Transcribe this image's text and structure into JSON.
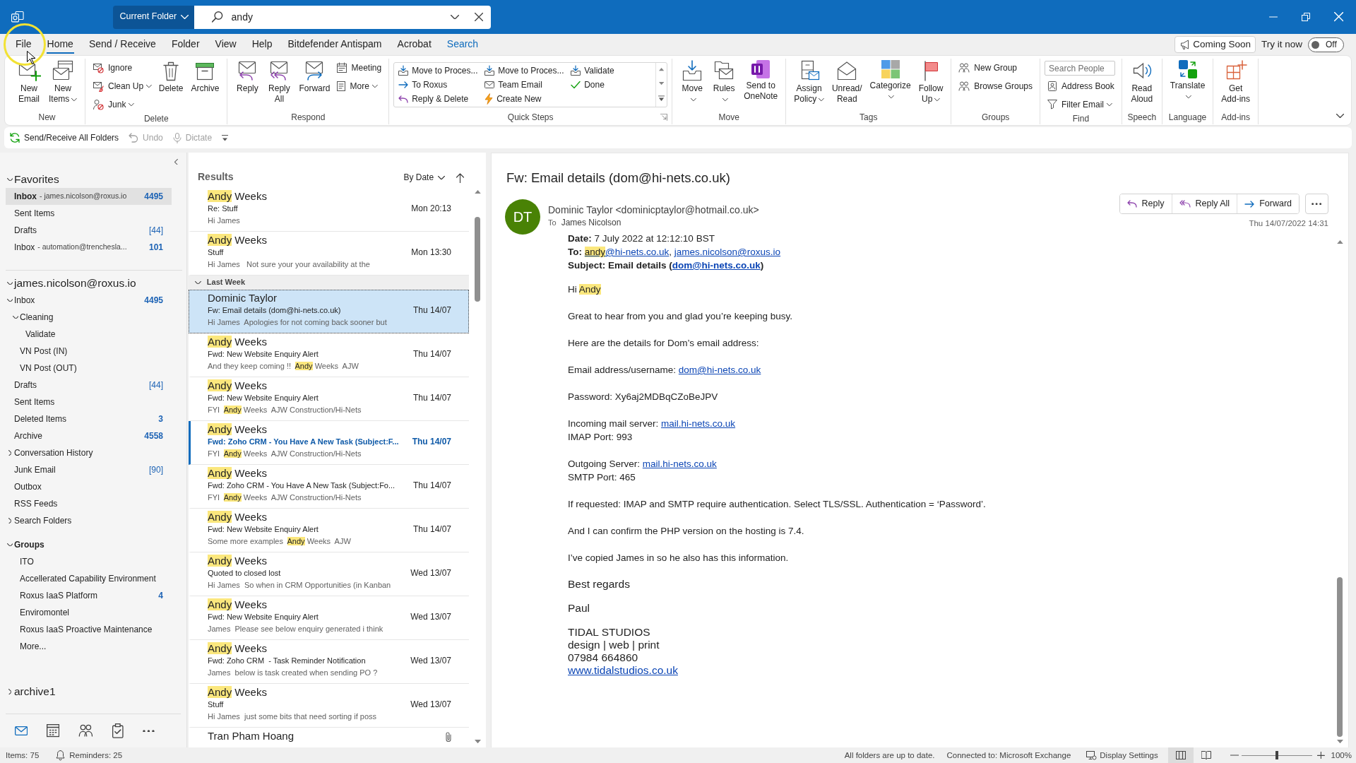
{
  "title_bar": {
    "scope": "Current Folder",
    "search": {
      "value": "andy"
    }
  },
  "menu_tabs": [
    {
      "label": "File",
      "selected": false,
      "kind": "standard"
    },
    {
      "label": "Home",
      "selected": true,
      "kind": "standard"
    },
    {
      "label": "Send / Receive",
      "selected": false,
      "kind": "standard"
    },
    {
      "label": "Folder",
      "selected": false,
      "kind": "standard"
    },
    {
      "label": "View",
      "selected": false,
      "kind": "standard"
    },
    {
      "label": "Help",
      "selected": false,
      "kind": "standard"
    },
    {
      "label": "Bitdefender Antispam",
      "selected": false,
      "kind": "standard"
    },
    {
      "label": "Acrobat",
      "selected": false,
      "kind": "standard"
    },
    {
      "label": "Search",
      "selected": false,
      "kind": "contextual"
    }
  ],
  "coming_soon": "Coming Soon",
  "try_it_now": {
    "label": "Try it now",
    "toggle": {
      "label": "Off",
      "on": false
    }
  },
  "ribbon": {
    "groups": [
      {
        "label": "New",
        "items": [
          {
            "kind": "large",
            "lines": [
              "New",
              "Email"
            ],
            "menu": false
          },
          {
            "kind": "large",
            "lines": [
              "New",
              "Items"
            ],
            "menu": true
          }
        ]
      },
      {
        "label": "Delete",
        "items": [
          {
            "kind": "stack",
            "items": [
              {
                "label": "Ignore",
                "menu": false
              },
              {
                "label": "Clean Up",
                "menu": true
              },
              {
                "label": "Junk",
                "menu": true
              }
            ]
          },
          {
            "kind": "large",
            "lines": [
              "Delete"
            ],
            "menu": false
          },
          {
            "kind": "large",
            "lines": [
              "Archive"
            ],
            "menu": false
          }
        ]
      },
      {
        "label": "Respond",
        "items": [
          {
            "kind": "large",
            "lines": [
              "Reply"
            ],
            "menu": false
          },
          {
            "kind": "large",
            "lines": [
              "Reply",
              "All"
            ],
            "menu": false
          },
          {
            "kind": "large",
            "lines": [
              "Forward"
            ],
            "menu": false
          },
          {
            "kind": "stack",
            "items": [
              {
                "label": "Meeting",
                "menu": false
              },
              {
                "label": "More",
                "menu": true
              }
            ]
          }
        ]
      },
      {
        "label": "Quick Steps",
        "items": [
          {
            "kind": "gallery",
            "items": [
              "Move to Proces...",
              "To Roxus",
              "Reply & Delete",
              "Move to Proces...",
              "Team Email",
              "Create New",
              "Validate",
              "Done"
            ]
          }
        ]
      },
      {
        "label": "Move",
        "items": [
          {
            "kind": "large",
            "lines": [
              "Move"
            ],
            "menu": true
          },
          {
            "kind": "large",
            "lines": [
              "Rules"
            ],
            "menu": true
          },
          {
            "kind": "large",
            "lines": [
              "Send to",
              "OneNote"
            ],
            "menu": false
          }
        ]
      },
      {
        "label": "Tags",
        "items": [
          {
            "kind": "large",
            "lines": [
              "Assign",
              "Policy"
            ],
            "menu": true
          },
          {
            "kind": "large",
            "lines": [
              "Unread/",
              "Read"
            ],
            "menu": false
          },
          {
            "kind": "large",
            "lines": [
              "Categorize"
            ],
            "menu": true
          },
          {
            "kind": "large",
            "lines": [
              "Follow",
              "Up"
            ],
            "menu": true
          }
        ]
      },
      {
        "label": "Groups",
        "items": [
          {
            "kind": "stack",
            "items": [
              {
                "label": "New Group",
                "menu": false
              },
              {
                "label": "Browse Groups",
                "menu": false
              }
            ]
          }
        ]
      },
      {
        "label": "Find",
        "items": [
          {
            "kind": "stack",
            "items": [
              {
                "kind": "field",
                "placeholder": "Search People"
              },
              {
                "kind": "button",
                "label": "Address Book",
                "menu": false
              },
              {
                "kind": "button",
                "label": "Filter Email",
                "menu": true
              }
            ]
          }
        ]
      },
      {
        "label": "Speech",
        "items": [
          {
            "kind": "large",
            "lines": [
              "Read",
              "Aloud"
            ],
            "menu": false
          }
        ]
      },
      {
        "label": "Language",
        "items": [
          {
            "kind": "large",
            "lines": [
              "Translate"
            ],
            "menu": true
          }
        ]
      },
      {
        "label": "Add-ins",
        "items": [
          {
            "kind": "large",
            "lines": [
              "Get",
              "Add-ins"
            ],
            "menu": false
          }
        ]
      }
    ]
  },
  "quick_access": [
    {
      "label": "Send/Receive All Folders",
      "disabled": false
    },
    {
      "label": "Undo",
      "disabled": true
    },
    {
      "label": "Dictate",
      "disabled": true
    }
  ],
  "folder_pane": {
    "sections": [
      {
        "kind": "favorites",
        "label": "Favorites",
        "expanded": true,
        "folders": [
          {
            "label": "Inbox",
            "account": "- james.nicolson@roxus.io",
            "count": "4495",
            "count_unread": true,
            "selected": true
          },
          {
            "label": "Sent Items",
            "selected": false
          },
          {
            "label": "Drafts",
            "count": "[44]",
            "count_unread": false,
            "selected": false
          },
          {
            "label": "Inbox",
            "account": "- automation@trenchesla...",
            "count": "101",
            "count_unread": true,
            "selected": false
          }
        ]
      },
      {
        "kind": "account",
        "label": "james.nicolson@roxus.io",
        "expanded": true,
        "folders": [
          {
            "label": "Inbox",
            "count": "4495",
            "count_unread": true,
            "selected": false,
            "expanded": true,
            "children": [
              {
                "label": "Cleaning",
                "selected": false,
                "expanded": true,
                "children": [
                  {
                    "label": "Validate",
                    "selected": false
                  }
                ]
              },
              {
                "label": "VN Post (IN)",
                "selected": false
              },
              {
                "label": "VN Post (OUT)",
                "selected": false
              }
            ]
          },
          {
            "label": "Drafts",
            "count": "[44]",
            "count_unread": false,
            "selected": false
          },
          {
            "label": "Sent Items",
            "selected": false
          },
          {
            "label": "Deleted Items",
            "count": "3",
            "count_unread": true,
            "selected": false
          },
          {
            "label": "Archive",
            "count": "4558",
            "count_unread": true,
            "selected": false
          },
          {
            "label": "Conversation History",
            "selected": false,
            "expanded": false
          },
          {
            "label": "Junk Email",
            "count": "[90]",
            "count_unread": false,
            "selected": false
          },
          {
            "label": "Outbox",
            "selected": false
          },
          {
            "label": "RSS Feeds",
            "selected": false
          },
          {
            "label": "Search Folders",
            "selected": false,
            "expanded": false
          }
        ]
      },
      {
        "kind": "groups",
        "label": "Groups",
        "expanded": true,
        "folders": [
          {
            "label": "ITO",
            "selected": false
          },
          {
            "label": "Accellerated Capability Environment",
            "selected": false
          },
          {
            "label": "Roxus IaaS Platform",
            "count": "4",
            "count_unread": true,
            "selected": false
          },
          {
            "label": "Enviromontel",
            "selected": false
          },
          {
            "label": "Roxus IaaS Proactive Maintenance",
            "selected": false
          },
          {
            "label": "More...",
            "selected": false
          }
        ]
      },
      {
        "kind": "account",
        "label": "archive1",
        "expanded": false
      }
    ]
  },
  "nav_bar": [
    {
      "selected": true
    },
    {
      "selected": false
    },
    {
      "selected": false
    },
    {
      "selected": false
    },
    {
      "selected": false
    }
  ],
  "message_list": {
    "title": "Results",
    "sort": "By Date",
    "items": [
      {
        "kind": "message",
        "sender": [
          {
            "kind": "hit",
            "text": "Andy"
          },
          {
            "kind": "text",
            "text": " Weeks"
          }
        ],
        "subject": "Re: Stuff",
        "preview": [
          {
            "kind": "text",
            "text": "Hi James"
          }
        ],
        "date": "Mon 20:13",
        "selected": false,
        "unread": false,
        "attachment": false
      },
      {
        "kind": "message",
        "sender": [
          {
            "kind": "hit",
            "text": "Andy"
          },
          {
            "kind": "text",
            "text": " Weeks"
          }
        ],
        "subject": "Stuff",
        "preview": [
          {
            "kind": "text",
            "text": "Hi James   Not sure your your availability at the"
          }
        ],
        "date": "Mon 13:30",
        "selected": false,
        "unread": false,
        "attachment": false
      },
      {
        "kind": "group_header",
        "label": "Last Week",
        "expanded": true
      },
      {
        "kind": "message",
        "sender": [
          {
            "kind": "text",
            "text": "Dominic Taylor"
          }
        ],
        "subject": "Fw: Email details (dom@hi-nets.co.uk)",
        "preview": [
          {
            "kind": "text",
            "text": "Hi James  Apologies for not coming back sooner but"
          }
        ],
        "date": "Thu 14/07",
        "selected": true,
        "unread": false,
        "attachment": false
      },
      {
        "kind": "message",
        "sender": [
          {
            "kind": "hit",
            "text": "Andy"
          },
          {
            "kind": "text",
            "text": " Weeks"
          }
        ],
        "subject": "Fwd: New Website Enquiry Alert",
        "preview": [
          {
            "kind": "text",
            "text": "And they keep coming !!  "
          },
          {
            "kind": "hit",
            "text": "Andy"
          },
          {
            "kind": "text",
            "text": " Weeks  AJW"
          }
        ],
        "date": "Thu 14/07",
        "selected": false,
        "unread": false,
        "attachment": false
      },
      {
        "kind": "message",
        "sender": [
          {
            "kind": "hit",
            "text": "Andy"
          },
          {
            "kind": "text",
            "text": " Weeks"
          }
        ],
        "subject": "Fwd: New Website Enquiry Alert",
        "preview": [
          {
            "kind": "text",
            "text": "FYI  "
          },
          {
            "kind": "hit",
            "text": "Andy"
          },
          {
            "kind": "text",
            "text": " Weeks  AJW Construction/Hi-Nets"
          }
        ],
        "date": "Thu 14/07",
        "selected": false,
        "unread": false,
        "attachment": false
      },
      {
        "kind": "message",
        "sender": [
          {
            "kind": "hit",
            "text": "Andy"
          },
          {
            "kind": "text",
            "text": " Weeks"
          }
        ],
        "subject": "Fwd: Zoho CRM - You Have A New Task (Subject:F...",
        "preview": [
          {
            "kind": "text",
            "text": "FYI  "
          },
          {
            "kind": "hit",
            "text": "Andy"
          },
          {
            "kind": "text",
            "text": " Weeks  AJW Construction/Hi-Nets"
          }
        ],
        "date": "Thu 14/07",
        "selected": false,
        "unread": true,
        "attachment": false
      },
      {
        "kind": "message",
        "sender": [
          {
            "kind": "hit",
            "text": "Andy"
          },
          {
            "kind": "text",
            "text": " Weeks"
          }
        ],
        "subject": "Fwd: Zoho CRM - You Have A New Task (Subject:Fo...",
        "preview": [
          {
            "kind": "text",
            "text": "FYI  "
          },
          {
            "kind": "hit",
            "text": "Andy"
          },
          {
            "kind": "text",
            "text": " Weeks  AJW Construction/Hi-Nets"
          }
        ],
        "date": "Thu 14/07",
        "selected": false,
        "unread": false,
        "attachment": false
      },
      {
        "kind": "message",
        "sender": [
          {
            "kind": "hit",
            "text": "Andy"
          },
          {
            "kind": "text",
            "text": " Weeks"
          }
        ],
        "subject": "Fwd: New Website Enquiry Alert",
        "preview": [
          {
            "kind": "text",
            "text": "Some more examples  "
          },
          {
            "kind": "hit",
            "text": "Andy"
          },
          {
            "kind": "text",
            "text": " Weeks  AJW"
          }
        ],
        "date": "Thu 14/07",
        "selected": false,
        "unread": false,
        "attachment": false
      },
      {
        "kind": "message",
        "sender": [
          {
            "kind": "hit",
            "text": "Andy"
          },
          {
            "kind": "text",
            "text": " Weeks"
          }
        ],
        "subject": "Quoted to closed lost",
        "preview": [
          {
            "kind": "text",
            "text": "Hi James  So when in CRM Opportunities (in Kanban"
          }
        ],
        "date": "Wed 13/07",
        "selected": false,
        "unread": false,
        "attachment": false
      },
      {
        "kind": "message",
        "sender": [
          {
            "kind": "hit",
            "text": "Andy"
          },
          {
            "kind": "text",
            "text": " Weeks"
          }
        ],
        "subject": "Fwd: New Website Enquiry Alert",
        "preview": [
          {
            "kind": "text",
            "text": "James  Please see below enquiry generated i think"
          }
        ],
        "date": "Wed 13/07",
        "selected": false,
        "unread": false,
        "attachment": false
      },
      {
        "kind": "message",
        "sender": [
          {
            "kind": "hit",
            "text": "Andy"
          },
          {
            "kind": "text",
            "text": " Weeks"
          }
        ],
        "subject": "Fwd: Zoho CRM  - Task Reminder Notification",
        "preview": [
          {
            "kind": "text",
            "text": "James  below is task created when sending PO ?"
          }
        ],
        "date": "Wed 13/07",
        "selected": false,
        "unread": false,
        "attachment": false
      },
      {
        "kind": "message",
        "sender": [
          {
            "kind": "hit",
            "text": "Andy"
          },
          {
            "kind": "text",
            "text": " Weeks"
          }
        ],
        "subject": "Stuff",
        "preview": [
          {
            "kind": "text",
            "text": "Hi James  just some bits that need sorting if poss"
          }
        ],
        "date": "Wed 13/07",
        "selected": false,
        "unread": false,
        "attachment": false
      },
      {
        "kind": "message",
        "sender": [
          {
            "kind": "text",
            "text": "Tran Pham Hoang"
          }
        ],
        "selected": false,
        "unread": false,
        "attachment": true
      }
    ]
  },
  "reading_pane": {
    "subject": "Fw: Email details (dom@hi-nets.co.uk)",
    "avatar": "DT",
    "from": "Dominic Taylor <dominicptaylor@hotmail.co.uk>",
    "to_label": "To",
    "to": "James Nicolson",
    "actions": [
      "Reply",
      "Reply All",
      "Forward"
    ],
    "date": "Thu 14/07/2022 14:31",
    "body": [
      {
        "kind": "body",
        "lines": [
          [
            {
              "kind": "bold",
              "text": "Date:"
            },
            {
              "kind": "text",
              "text": " 7 July 2022 at 12:12:10 BST"
            }
          ],
          [
            {
              "kind": "bold",
              "text": "To: "
            },
            {
              "kind": "link",
              "parts": [
                {
                  "text": "andy",
                  "hit": true
                },
                {
                  "text": "@hi-nets.co.uk",
                  "hit": false
                }
              ]
            },
            {
              "kind": "text",
              "text": ", "
            },
            {
              "kind": "link",
              "text": "james.nicolson@roxus.io"
            }
          ],
          [
            {
              "kind": "bold",
              "text": "Subject: Email details ("
            },
            {
              "kind": "bold_link",
              "text": "dom@hi-nets.co.uk"
            },
            {
              "kind": "bold",
              "text": ")"
            }
          ]
        ]
      },
      {
        "kind": "body",
        "lines": [
          [
            {
              "kind": "text",
              "text": "Hi "
            },
            {
              "kind": "hit",
              "text": "Andy"
            }
          ]
        ]
      },
      {
        "kind": "body",
        "lines": [
          [
            {
              "kind": "text",
              "text": "Great to hear from you and glad you’re keeping busy."
            }
          ]
        ]
      },
      {
        "kind": "body",
        "lines": [
          [
            {
              "kind": "text",
              "text": "Here are the details for Dom’s email address:"
            }
          ]
        ]
      },
      {
        "kind": "body",
        "lines": [
          [
            {
              "kind": "text",
              "text": "Email address/username: "
            },
            {
              "kind": "link",
              "text": "dom@hi-nets.co.uk"
            }
          ]
        ]
      },
      {
        "kind": "body",
        "lines": [
          [
            {
              "kind": "text",
              "text": "Password: Xy6aj2MDBqCZoBeJPV"
            }
          ]
        ]
      },
      {
        "kind": "body",
        "lines": [
          [
            {
              "kind": "text",
              "text": "Incoming mail server: "
            },
            {
              "kind": "link",
              "text": "mail.hi-nets.co.uk"
            }
          ],
          [
            {
              "kind": "text",
              "text": "IMAP Port: 993"
            }
          ]
        ]
      },
      {
        "kind": "body",
        "lines": [
          [
            {
              "kind": "text",
              "text": "Outgoing Server: "
            },
            {
              "kind": "link",
              "text": "mail.hi-nets.co.uk"
            }
          ],
          [
            {
              "kind": "text",
              "text": "SMTP Port: 465"
            }
          ]
        ]
      },
      {
        "kind": "body",
        "lines": [
          [
            {
              "kind": "text",
              "text": "If requested: IMAP and SMTP require authentication. Select TLS/SSL. Authentication = ‘Password’."
            }
          ]
        ]
      },
      {
        "kind": "body",
        "lines": [
          [
            {
              "kind": "text",
              "text": "And I can confirm the PHP version on the hosting is 7.4."
            }
          ]
        ]
      },
      {
        "kind": "body",
        "lines": [
          [
            {
              "kind": "text",
              "text": "I’ve copied James in so he also has this information."
            }
          ]
        ]
      },
      {
        "kind": "signature",
        "lines": [
          [
            {
              "kind": "text",
              "text": "Best regards"
            }
          ]
        ]
      },
      {
        "kind": "signature",
        "lines": [
          [
            {
              "kind": "text",
              "text": "Paul"
            }
          ]
        ]
      },
      {
        "kind": "signature",
        "lines": [
          [
            {
              "kind": "text",
              "text": "TIDAL STUDIOS"
            }
          ],
          [
            {
              "kind": "text",
              "text": "design | web | print"
            }
          ],
          [
            {
              "kind": "text",
              "text": "07984 664860"
            }
          ],
          [
            {
              "kind": "link",
              "text": "www.tidalstudios.co.uk"
            }
          ]
        ]
      }
    ]
  },
  "status_bar": {
    "items": "Items: 75",
    "reminders": "Reminders: 25",
    "sync": "All folders are up to date.",
    "connection": "Connected to: Microsoft Exchange",
    "display_settings": "Display Settings",
    "views": [
      {
        "selected": true
      },
      {
        "selected": false
      }
    ],
    "zoom": {
      "level": 0.5,
      "label": "100%"
    }
  }
}
